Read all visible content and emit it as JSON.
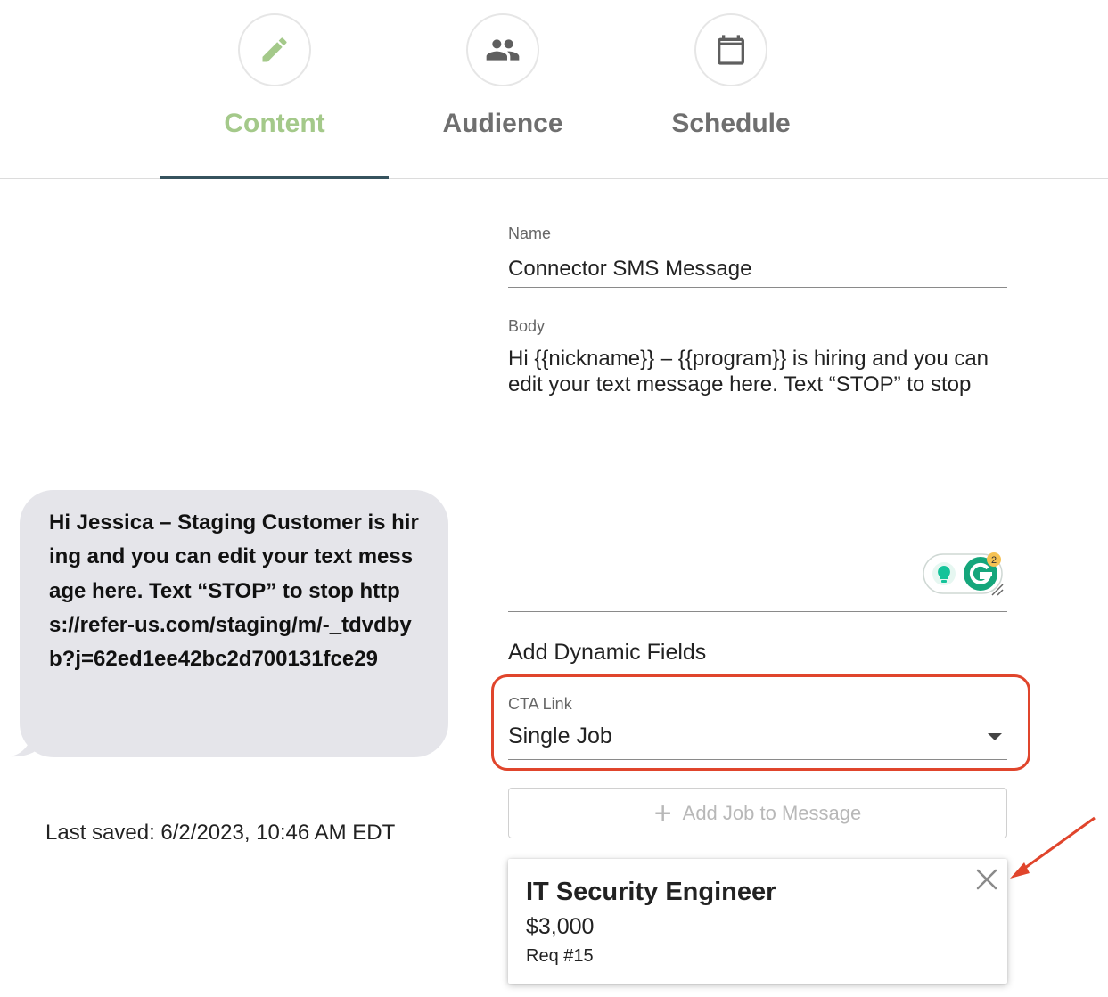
{
  "tabs": [
    {
      "label": "Content",
      "icon": "pencil-icon",
      "active": true
    },
    {
      "label": "Audience",
      "icon": "people-icon",
      "active": false
    },
    {
      "label": "Schedule",
      "icon": "calendar-icon",
      "active": false
    }
  ],
  "preview": {
    "message": "Hi Jessica – Staging Customer is hiring and you can edit your text message here. Text “STOP” to stop https://refer-us.com/staging/m/-_tdvdbyb?j=62ed1ee42bc2d700131fce29",
    "last_saved": "Last saved: 6/2/2023, 10:46 AM EDT"
  },
  "form": {
    "name_label": "Name",
    "name_value": "Connector SMS Message",
    "body_label": "Body",
    "body_value": "Hi {{nickname}} – {{program}} is hiring and you can edit your text message here. Text “STOP” to stop",
    "grammarly_count": "2",
    "dynamic_fields_title": "Add Dynamic Fields",
    "cta_label": "CTA Link",
    "cta_value": "Single Job",
    "add_job_label": "Add Job to Message"
  },
  "job": {
    "title": "IT Security Engineer",
    "amount": "$3,000",
    "req": "Req #15"
  },
  "colors": {
    "active_tab": "#a4c98a",
    "tab_underline": "#36535e",
    "highlight": "#e0452c",
    "bubble": "#e5e5ea"
  }
}
